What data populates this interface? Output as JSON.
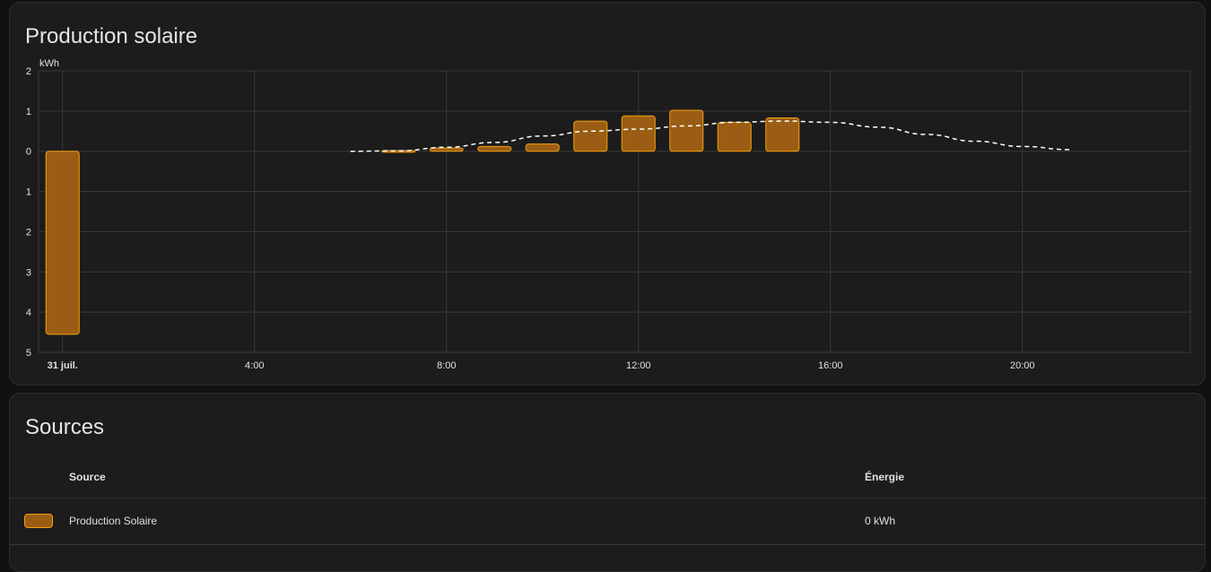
{
  "chart_card": {
    "title": "Production solaire"
  },
  "chart_data": {
    "type": "bar",
    "unit": "kWh",
    "y_ticks": [
      "2",
      "1",
      "0",
      "1",
      "2",
      "3",
      "4",
      "5"
    ],
    "y_range": [
      -5,
      2
    ],
    "x_range_hours": [
      -0.5,
      23.5
    ],
    "x_ticks": [
      {
        "hour": 0,
        "label": "31 juil.",
        "bold": true
      },
      {
        "hour": 4,
        "label": "4:00",
        "bold": false
      },
      {
        "hour": 8,
        "label": "8:00",
        "bold": false
      },
      {
        "hour": 12,
        "label": "12:00",
        "bold": false
      },
      {
        "hour": 16,
        "label": "16:00",
        "bold": false
      },
      {
        "hour": 20,
        "label": "20:00",
        "bold": false
      }
    ],
    "series": [
      {
        "name": "Production Solaire",
        "kind": "bar",
        "color": "#f5a00e",
        "fill": "#9a5d13",
        "points": [
          {
            "hour": 0,
            "value": -4.55
          },
          {
            "hour": 7,
            "value": 0.02
          },
          {
            "hour": 8,
            "value": 0.08
          },
          {
            "hour": 9,
            "value": 0.12
          },
          {
            "hour": 10,
            "value": 0.18
          },
          {
            "hour": 11,
            "value": 0.75
          },
          {
            "hour": 12,
            "value": 0.88
          },
          {
            "hour": 13,
            "value": 1.02
          },
          {
            "hour": 14,
            "value": 0.72
          },
          {
            "hour": 15,
            "value": 0.83
          }
        ]
      },
      {
        "kind": "line-dashed",
        "color": "#ffffff",
        "points": [
          {
            "hour": 6.0,
            "value": 0.0
          },
          {
            "hour": 7.0,
            "value": 0.01
          },
          {
            "hour": 8.0,
            "value": 0.1
          },
          {
            "hour": 9.0,
            "value": 0.22
          },
          {
            "hour": 10.0,
            "value": 0.38
          },
          {
            "hour": 11.0,
            "value": 0.5
          },
          {
            "hour": 12.0,
            "value": 0.55
          },
          {
            "hour": 13.0,
            "value": 0.63
          },
          {
            "hour": 14.0,
            "value": 0.72
          },
          {
            "hour": 15.0,
            "value": 0.75
          },
          {
            "hour": 16.0,
            "value": 0.72
          },
          {
            "hour": 17.0,
            "value": 0.6
          },
          {
            "hour": 18.0,
            "value": 0.42
          },
          {
            "hour": 19.0,
            "value": 0.25
          },
          {
            "hour": 20.0,
            "value": 0.12
          },
          {
            "hour": 21.0,
            "value": 0.04
          }
        ]
      }
    ]
  },
  "sources_card": {
    "title": "Sources",
    "columns": {
      "source": "Source",
      "energy": "Énergie"
    },
    "rows": [
      {
        "source": "Production Solaire",
        "energy": "0 kWh",
        "color": "#f5a00e"
      }
    ]
  }
}
